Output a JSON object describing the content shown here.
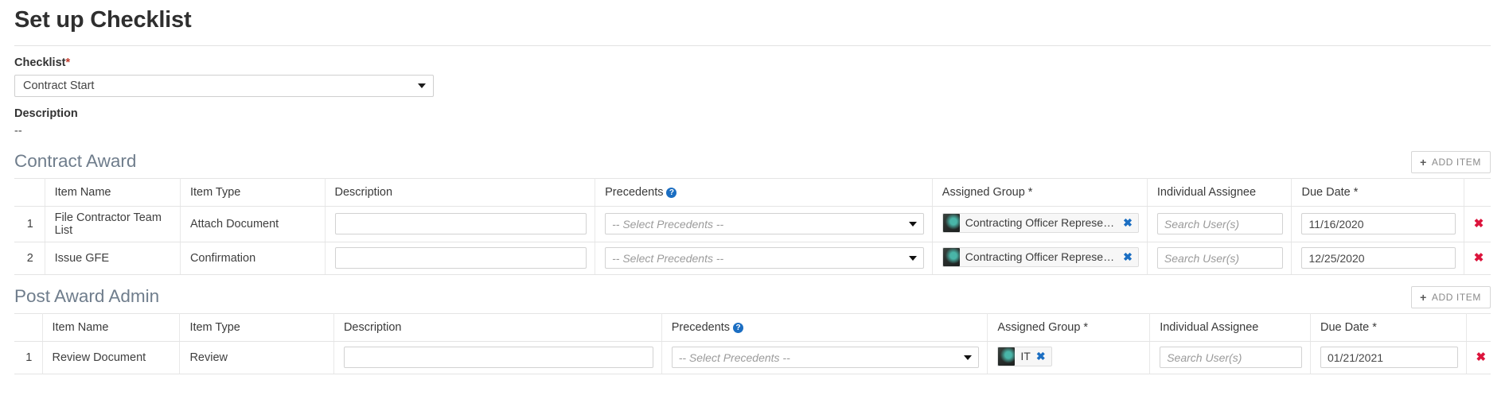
{
  "page": {
    "title": "Set up Checklist"
  },
  "checklist_field": {
    "label": "Checklist",
    "required_marker": "*",
    "value": "Contract Start",
    "caret_icon": "chevron-down-icon"
  },
  "description_field": {
    "label": "Description",
    "value": "--"
  },
  "columns": {
    "index": "",
    "item_name": "Item Name",
    "item_type": "Item Type",
    "description": "Description",
    "precedents": "Precedents",
    "precedents_help": "?",
    "assigned_group": "Assigned Group *",
    "individual_assignee": "Individual Assignee",
    "due_date": "Due Date *",
    "actions": ""
  },
  "placeholders": {
    "precedents": "-- Select Precedents --",
    "individual_assignee": "Search User(s)",
    "description": ""
  },
  "add_item_button": {
    "label": "ADD ITEM",
    "plus": "+"
  },
  "icons": {
    "remove_chip": "✖",
    "delete_row": "✖"
  },
  "colors": {
    "accent_blue": "#1b6ec2",
    "delete_red": "#dc143c",
    "section_title": "#6f7d8c",
    "required_star": "#c0392b"
  },
  "sections": [
    {
      "title": "Contract Award",
      "rows": [
        {
          "index": "1",
          "item_name": "File Contractor Team List",
          "item_type": "Attach Document",
          "description": "",
          "precedents": "-- Select Precedents --",
          "assigned_group": "Contracting Officer Representative",
          "individual_assignee": "",
          "due_date": "11/16/2020"
        },
        {
          "index": "2",
          "item_name": "Issue GFE",
          "item_type": "Confirmation",
          "description": "",
          "precedents": "-- Select Precedents --",
          "assigned_group": "Contracting Officer Representative",
          "individual_assignee": "",
          "due_date": "12/25/2020"
        }
      ]
    },
    {
      "title": "Post Award Admin",
      "rows": [
        {
          "index": "1",
          "item_name": "Review Document",
          "item_type": "Review",
          "description": "",
          "precedents": "-- Select Precedents --",
          "assigned_group": "IT",
          "individual_assignee": "",
          "due_date": "01/21/2021"
        }
      ]
    }
  ]
}
